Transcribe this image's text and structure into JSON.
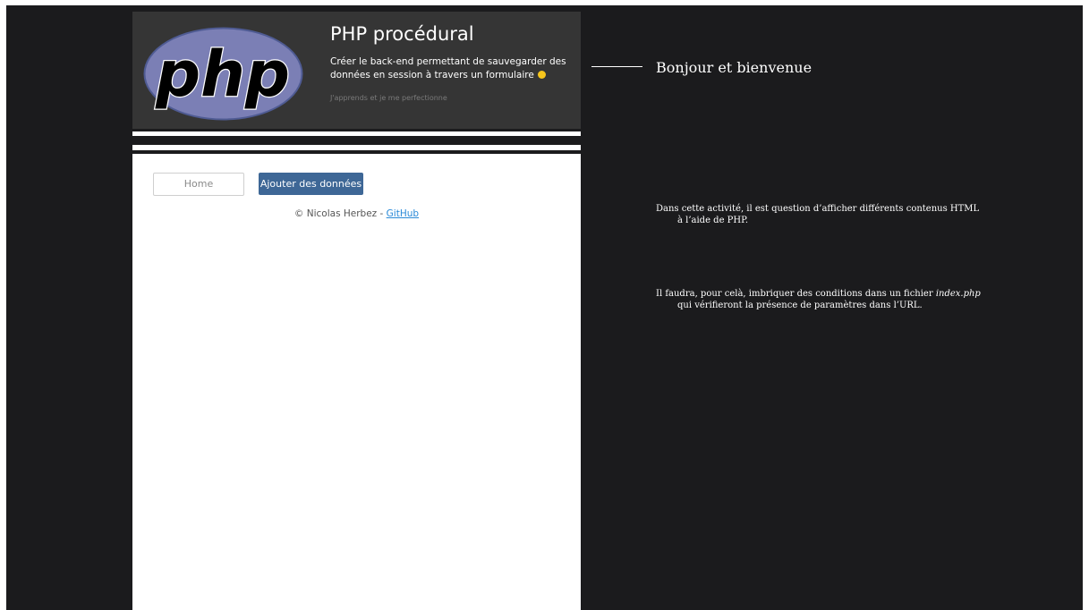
{
  "header": {
    "logo_text": "php",
    "title": "PHP procédural",
    "subtitle": "Créer le back-end permettant de sauvegarder des données en session à travers un formulaire",
    "tagline": "J'apprends et je me perfectionne"
  },
  "nav": {
    "home_label": "Home",
    "add_label": "Ajouter des données"
  },
  "footer": {
    "copyright": "© Nicolas Herbez - ",
    "link_label": "GitHub"
  },
  "right": {
    "greeting": "Bonjour et bienvenue",
    "para1_line1": "Dans cette activité, il est question d’afficher différents contenus HTML",
    "para1_line2": "à l’aide de PHP.",
    "para2_prefix": "Il faudra, pour celà, imbriquer des conditions dans un fichier ",
    "para2_file": "index.php",
    "para2_line2": "qui vérifieront la présence de paramètres dans l’URL."
  },
  "colors": {
    "page_bg": "#1b1b1d",
    "header_bg": "#353535",
    "button_primary": "#3e6796",
    "link": "#2a8ad8",
    "php_logo": "#7b7fb5"
  }
}
